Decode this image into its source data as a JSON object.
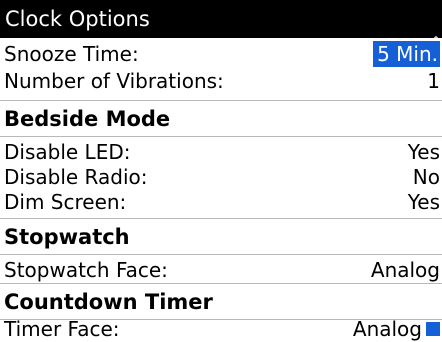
{
  "title": "Clock Options",
  "rows_top": [
    {
      "label": "Snooze Time:",
      "value": "5 Min."
    },
    {
      "label": "Number of Vibrations:",
      "value": "1"
    }
  ],
  "bedside": {
    "header": "Bedside Mode",
    "rows": [
      {
        "label": "Disable LED:",
        "value": "Yes"
      },
      {
        "label": "Disable Radio:",
        "value": "No"
      },
      {
        "label": "Dim Screen:",
        "value": "Yes"
      }
    ]
  },
  "stopwatch": {
    "header": "Stopwatch",
    "rows": [
      {
        "label": "Stopwatch Face:",
        "value": "Analog"
      }
    ]
  },
  "countdown": {
    "header": "Countdown Timer",
    "partial_row": {
      "label": "Timer Face:",
      "value": "Analog"
    }
  },
  "colors": {
    "titlebar": "#000000",
    "selection": "#1560d6",
    "divider": "#b8b8b8"
  },
  "icons": {
    "scroll_up": "up-arrow-icon",
    "scroll_down": "down-arrow-icon"
  }
}
